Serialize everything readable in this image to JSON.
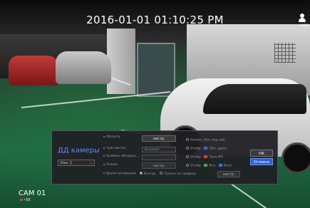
{
  "timestamp": "2016-01-01 01:10:25 PM",
  "login_label": "LOGIN",
  "camera": {
    "name": "CAM 01",
    "sub": "•SB"
  },
  "panel": {
    "title": "ДД камеры",
    "channel": "Кан. 1",
    "area_label": "Область",
    "area_button": "настр.",
    "sensitivity_label": "Чувствител",
    "sensitivity_value": "Высокая",
    "level_label": "Уровень обнаруж...",
    "mode_label": "Режим",
    "mode_button": "настр.",
    "activation_label": "Время активации",
    "activation_always": "Всегда",
    "activation_schedule": "Только по графику",
    "activation_button": "настр.",
    "right_option_1": "Налож. обл. под наб.",
    "right_option_2": "Отобр.",
    "right_option_2_tag": "Обл. движ.",
    "right_option_3": "Отобр.",
    "right_option_3_tag": "Зона ИП",
    "right_option_4": "Отобр.",
    "right_option_4_tag_a": "Вкл.",
    "right_option_4_tag_b": "Искл.",
    "ok": "OK",
    "cancel": "Отмена",
    "colors": {
      "title": "#5a8cff",
      "cancel": "#2f5fd8",
      "tag_blue": "#3a6ee8",
      "tag_red": "#e04040",
      "tag_green": "#3cb043"
    }
  }
}
